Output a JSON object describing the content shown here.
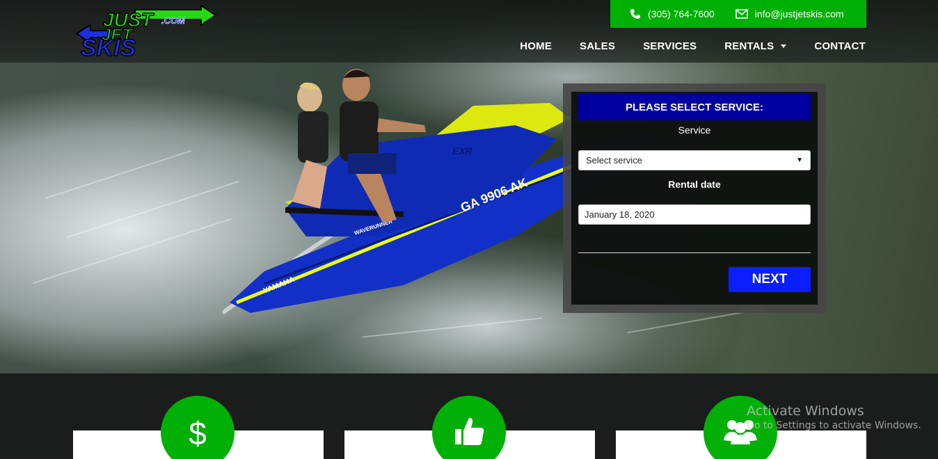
{
  "brand": {
    "logo_text_top": "JUST",
    "logo_text_mid": "JET",
    "logo_text_bottom": "SKIS",
    "logo_suffix": ".COM",
    "accent_green": "#00b006",
    "accent_blue": "#0a1eff"
  },
  "contact": {
    "phone": "(305) 764-7600",
    "email": "info@justjetskis.com",
    "phone_icon": "phone-icon",
    "email_icon": "envelope-icon"
  },
  "nav": {
    "items": [
      {
        "label": "HOME"
      },
      {
        "label": "SALES"
      },
      {
        "label": "SERVICES"
      },
      {
        "label": "RENTALS",
        "has_dropdown": true
      },
      {
        "label": "CONTACT"
      }
    ]
  },
  "hero": {
    "watercraft_text": "GA 9906 AK",
    "watercraft_brand": "YAMAHA",
    "watercraft_model": "EXR",
    "watercraft_series": "WAVERUNNER"
  },
  "booking": {
    "title": "PLEASE SELECT SERVICE:",
    "service_label": "Service",
    "service_value": "Select service",
    "date_label": "Rental date",
    "date_value": "January 18, 2020",
    "next_label": "NEXT"
  },
  "features": [
    {
      "icon": "dollar-icon"
    },
    {
      "icon": "thumbs-up-icon"
    },
    {
      "icon": "group-icon"
    }
  ],
  "os_watermark": {
    "title": "Activate Windows",
    "subtitle": "Go to Settings to activate Windows."
  }
}
